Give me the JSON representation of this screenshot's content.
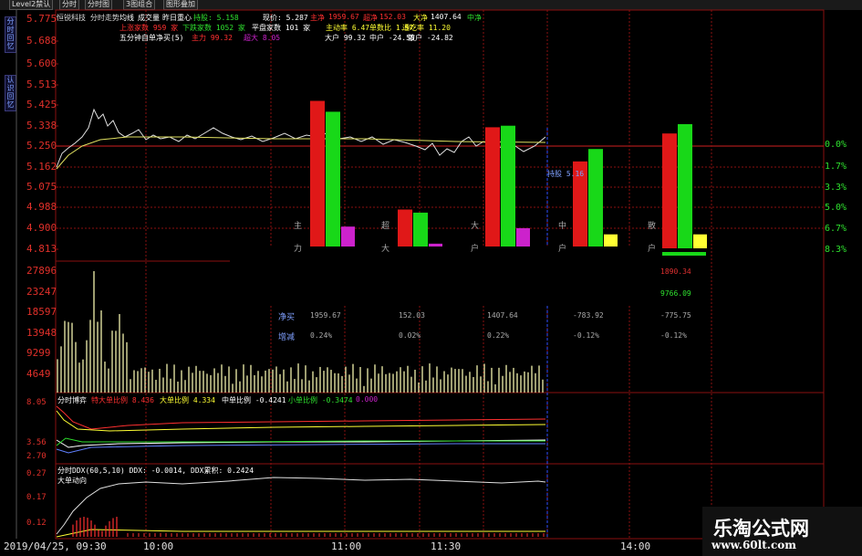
{
  "tabs": [
    {
      "label": "Level2禁认"
    },
    {
      "label": "分时"
    },
    {
      "label": "分时图"
    },
    {
      "label": "3图组合"
    },
    {
      "label": "图形叠加"
    }
  ],
  "sidebar": [
    {
      "label": "分时回忆"
    },
    {
      "label": "认识回忆"
    }
  ],
  "header_line1": {
    "name": "恒锐科技 分时走势",
    "avg": "均线",
    "vol": "成交量",
    "prev": "昨日重心",
    "pos": "持股: 5.158",
    "price": "现价: 5.287",
    "main_label": "主净",
    "main_val": "1959.67",
    "super_label": "超净",
    "super_val": "152.03",
    "big_label": "大净",
    "big_val": "1407.64",
    "mid_label": "中净"
  },
  "header_line2": {
    "up": "上涨家数 959 家",
    "down": "下跌家数 1052 家",
    "flat": "平盘家数 101 家",
    "active": "主动率 6.47",
    "order": "单数比 1.57",
    "pass": "通吃率 11.20"
  },
  "header_line3": {
    "title": "五分钟自单净买(5)",
    "main": "主力 99.32",
    "super": "超大 8.05",
    "big": "大户 99.32",
    "mid": "中户 -24.50",
    "retail": "散户 -24.82"
  },
  "price_axis": [
    "5.775",
    "5.688",
    "5.600",
    "5.513",
    "5.425",
    "5.338",
    "5.250",
    "5.162",
    "5.075",
    "4.988",
    "4.900",
    "4.813"
  ],
  "pct_axis": [
    "0.0%",
    "1.7%",
    "3.3%",
    "5.0%",
    "6.7%",
    "8.3%"
  ],
  "vol_axis": [
    "27896",
    "23247",
    "18597",
    "13948",
    "9299",
    "4649"
  ],
  "x_axis": [
    "2019/04/25, 09:30",
    "10:00",
    "11:00",
    "11:30",
    "14:00"
  ],
  "bar_labels": [
    "主",
    "超",
    "大",
    "中",
    "散",
    "力",
    "大",
    "户",
    "户",
    "户"
  ],
  "float_label": "持股 5.16",
  "net_values": {
    "label": "净买",
    "values": [
      "1959.67",
      "152.03",
      "1407.64",
      "-783.92",
      "-775.75"
    ]
  },
  "inc_values": {
    "label": "增减",
    "values": [
      "0.24%",
      "0.02%",
      "0.22%",
      "-0.12%",
      "-0.12%"
    ]
  },
  "right_vals": [
    "1890.34",
    "9766.09"
  ],
  "ind1": {
    "title": "分时博弈",
    "big": "特大单比例 8.436",
    "large": "大单比例 4.334",
    "mid": "中单比例 -0.4241",
    "small": "小单比例 -0.3474",
    "tail": "0.000",
    "axis": [
      "8.05",
      "3.56",
      "2.70"
    ]
  },
  "ind2": {
    "title": "分时DDX(60,5,10) DDX: -0.0014, DDX累积: 0.2424",
    "sub": "大单动向",
    "axis": [
      "0.27",
      "0.17",
      "0.12"
    ]
  },
  "watermark": {
    "cn": "乐淘公式网",
    "url": "www.60lt.com"
  },
  "chart_data": {
    "type": "bar",
    "title": "",
    "categories": [
      "主力",
      "超大",
      "大户",
      "中户",
      "散户"
    ],
    "series": [
      {
        "values": [
          1959.67,
          152.03,
          1407.64,
          -783.92,
          -775.75
        ]
      }
    ],
    "bars_red": [
      0.95,
      0.25,
      0.78,
      0.56,
      0.74
    ],
    "bars_green": [
      0.88,
      0.23,
      0.79,
      0.64,
      0.8
    ],
    "bars_yellow": [
      0.0,
      0.0,
      0.0,
      0.09,
      0.09
    ],
    "bars_magenta": [
      0.14,
      0.03,
      0.13,
      0.0,
      0.0
    ],
    "price_ylim": [
      4.813,
      5.775
    ],
    "volume_ylim": [
      0,
      27896
    ]
  },
  "colors": {
    "red": "#e01818",
    "green": "#18d818",
    "magenta": "#cc22cc",
    "yellow": "#ffff33",
    "grid": "#8a1010"
  }
}
